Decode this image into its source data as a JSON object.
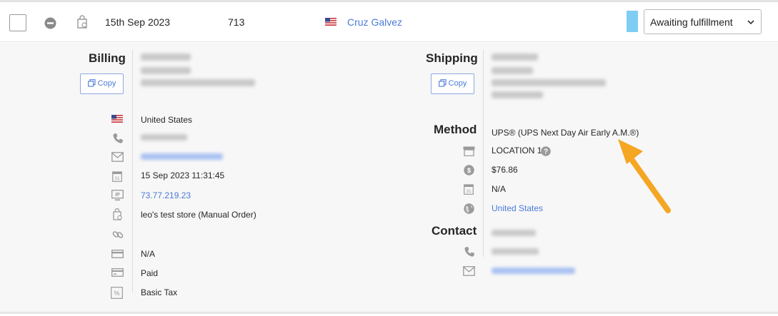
{
  "order": {
    "date": "15th Sep 2023",
    "id": "713",
    "customer_name": "Cruz Galvez",
    "status": "Awaiting fulfillment",
    "status_color": "#7fcdf5"
  },
  "billing": {
    "title": "Billing",
    "copy_label": "Copy",
    "country": "United States",
    "date": "15 Sep 2023 11:31:45",
    "ip": "73.77.219.23",
    "store": "leo's test store (Manual Order)",
    "payment_method": "N/A",
    "payment_status": "Paid",
    "tax": "Basic Tax"
  },
  "shipping": {
    "title": "Shipping",
    "copy_label": "Copy",
    "method_title": "Method",
    "method": "UPS® (UPS Next Day Air Early A.M.®)",
    "location": "LOCATION 1",
    "cost": "$76.86",
    "date": "N/A",
    "country": "United States"
  },
  "contact": {
    "title": "Contact"
  },
  "colors": {
    "link": "#4b7ad8",
    "arrow": "#f5a623",
    "panel_bg": "#f7f7f7"
  }
}
